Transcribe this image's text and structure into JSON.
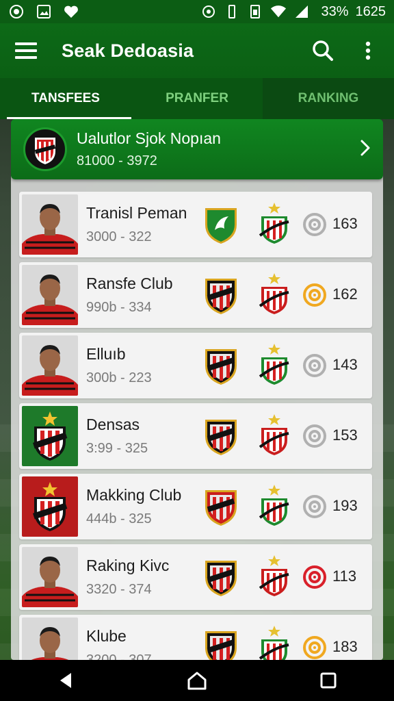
{
  "status_bar": {
    "battery": "33%",
    "time": "1625"
  },
  "app_bar": {
    "title": "Seak Dedoasia"
  },
  "tabs": [
    {
      "label": "TANSFEES",
      "active": true
    },
    {
      "label": "PRANFER",
      "active": false
    },
    {
      "label": "RANKING",
      "active": false
    }
  ],
  "featured": {
    "title": "Ualutlor Sjok Nopıan",
    "subtitle": "81000 - 3972"
  },
  "rows": [
    {
      "title": "Tranisl Peman",
      "subtitle": "3000 - 322",
      "score": "163",
      "thumb": "player",
      "target_color": "#b0b0b0"
    },
    {
      "title": "Ransfe Club",
      "subtitle": "990b - 334",
      "score": "162",
      "thumb": "player",
      "target_color": "#f0a820"
    },
    {
      "title": "Elluıb",
      "subtitle": "300b - 223",
      "score": "143",
      "thumb": "player",
      "target_color": "#b0b0b0"
    },
    {
      "title": "Densas",
      "subtitle": "3:99 - 325",
      "score": "153",
      "thumb": "crest-green",
      "target_color": "#b0b0b0"
    },
    {
      "title": "Makking Club",
      "subtitle": "444b - 325",
      "score": "193",
      "thumb": "crest-red",
      "target_color": "#b0b0b0"
    },
    {
      "title": "Raking Kivc",
      "subtitle": "3320 - 374",
      "score": "113",
      "thumb": "player",
      "target_color": "#d9202a"
    },
    {
      "title": "Klubе",
      "subtitle": "3200 - 307",
      "score": "183",
      "thumb": "player",
      "target_color": "#f0a820"
    }
  ],
  "colors": {
    "primary": "#0c5d14",
    "accent": "#108620"
  }
}
